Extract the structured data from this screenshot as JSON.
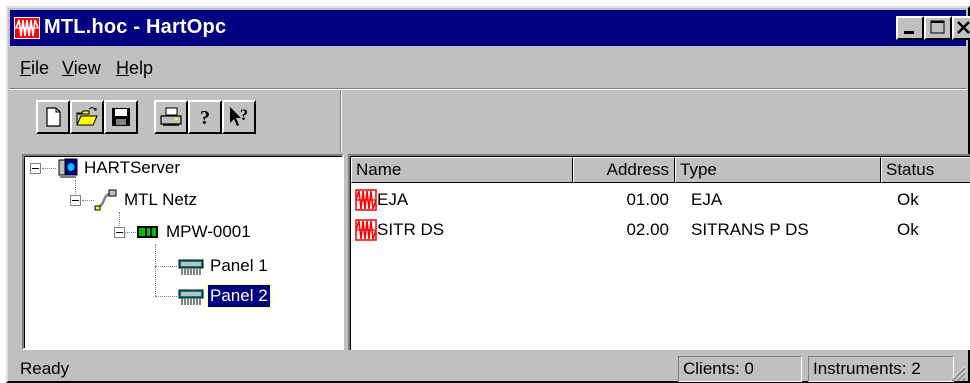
{
  "window": {
    "title": "MTL.hoc - HartOpc"
  },
  "menu": [
    {
      "label": "File",
      "ul": "F",
      "rest": "ile"
    },
    {
      "label": "View",
      "ul": "V",
      "rest": "iew"
    },
    {
      "label": "Help",
      "ul": "H",
      "rest": "elp"
    }
  ],
  "toolbar": [
    "new-document-icon",
    "open-folder-icon",
    "save-disk-icon",
    "print-icon",
    "help-icon",
    "context-help-icon"
  ],
  "tree": {
    "root": "HARTServer",
    "network": "MTL Netz",
    "device": "MPW-0001",
    "panels": [
      "Panel 1",
      "Panel 2"
    ],
    "selected": "Panel 2"
  },
  "list": {
    "columns": [
      "Name",
      "Address",
      "Type",
      "Status"
    ],
    "rows": [
      {
        "name": "EJA",
        "address": "01.00",
        "type": "EJA",
        "status": "Ok"
      },
      {
        "name": "SITR DS",
        "address": "02.00",
        "type": "SITRANS P DS",
        "status": "Ok"
      }
    ]
  },
  "status": {
    "ready": "Ready",
    "clients": "Clients: 0",
    "instruments": "Instruments: 2"
  },
  "colors": {
    "titlebar": "#000080",
    "face": "#c0c0c0",
    "selection": "#000080",
    "hart_icon": "#ff0000"
  }
}
